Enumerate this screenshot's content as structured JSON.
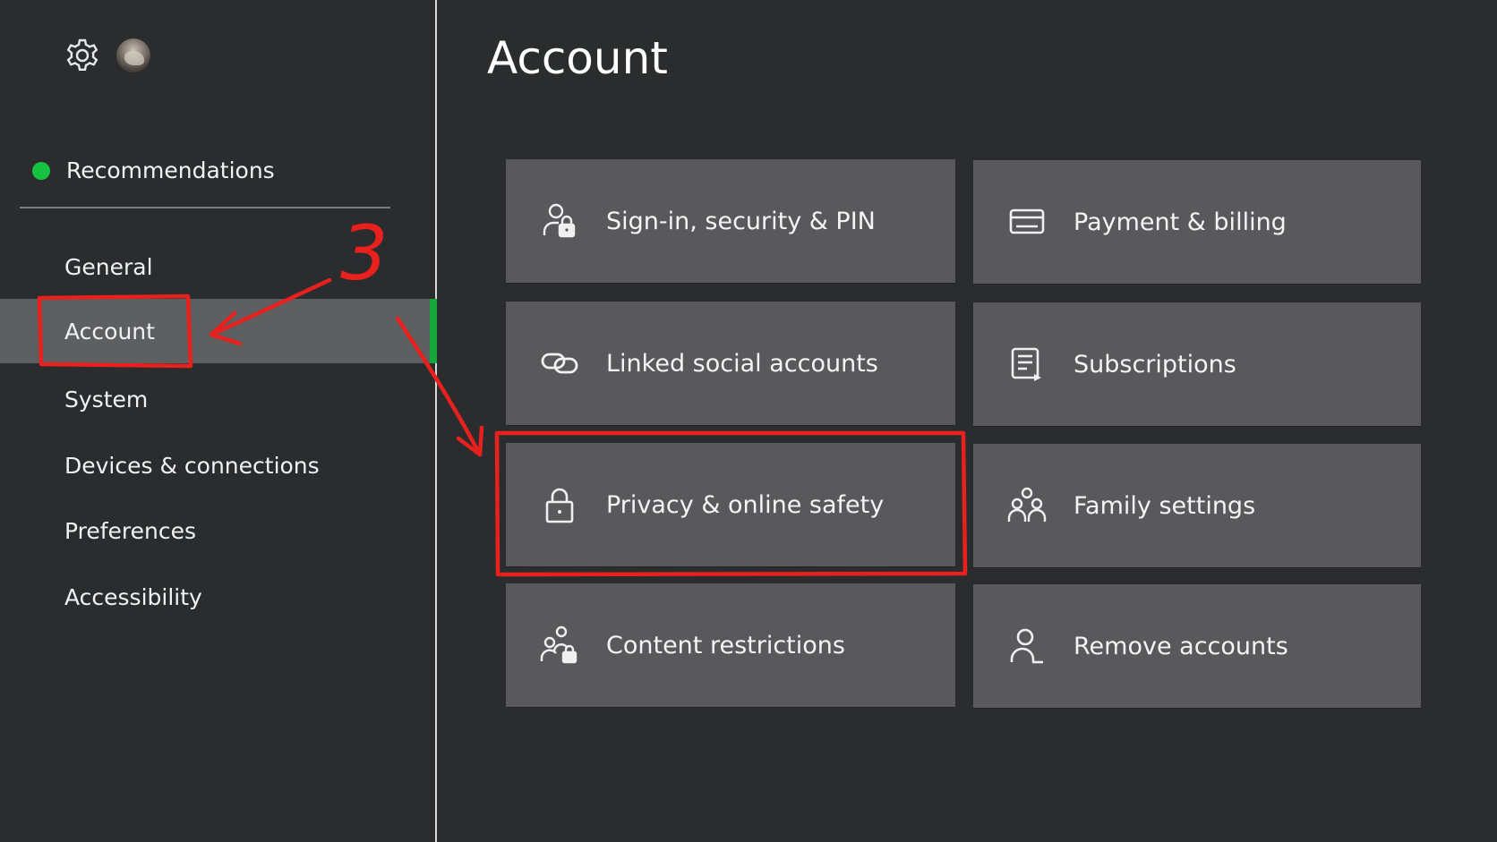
{
  "sidebar": {
    "recommendations": "Recommendations",
    "items": [
      {
        "label": "General"
      },
      {
        "label": "Account"
      },
      {
        "label": "System"
      },
      {
        "label": "Devices & connections"
      },
      {
        "label": "Preferences"
      },
      {
        "label": "Accessibility"
      }
    ],
    "selected": "Account",
    "icons": [
      "gear-icon",
      "avatar"
    ]
  },
  "main": {
    "title": "Account",
    "tiles": [
      {
        "label": "Sign-in, security & PIN",
        "icon": "user-lock-icon"
      },
      {
        "label": "Payment & billing",
        "icon": "credit-card-icon"
      },
      {
        "label": "Linked social accounts",
        "icon": "link-icon"
      },
      {
        "label": "Subscriptions",
        "icon": "subscriptions-icon"
      },
      {
        "label": "Privacy & online safety",
        "icon": "lock-icon"
      },
      {
        "label": "Family settings",
        "icon": "family-icon"
      },
      {
        "label": "Content restrictions",
        "icon": "family-lock-icon"
      },
      {
        "label": "Remove accounts",
        "icon": "person-remove-icon"
      }
    ]
  },
  "annotation": {
    "step_number": "3",
    "color": "#e8201e"
  },
  "colors": {
    "background": "#2b2c2e",
    "tile": "#59595b",
    "selected": "#5e5f61",
    "accent_green": "#16c23f"
  }
}
